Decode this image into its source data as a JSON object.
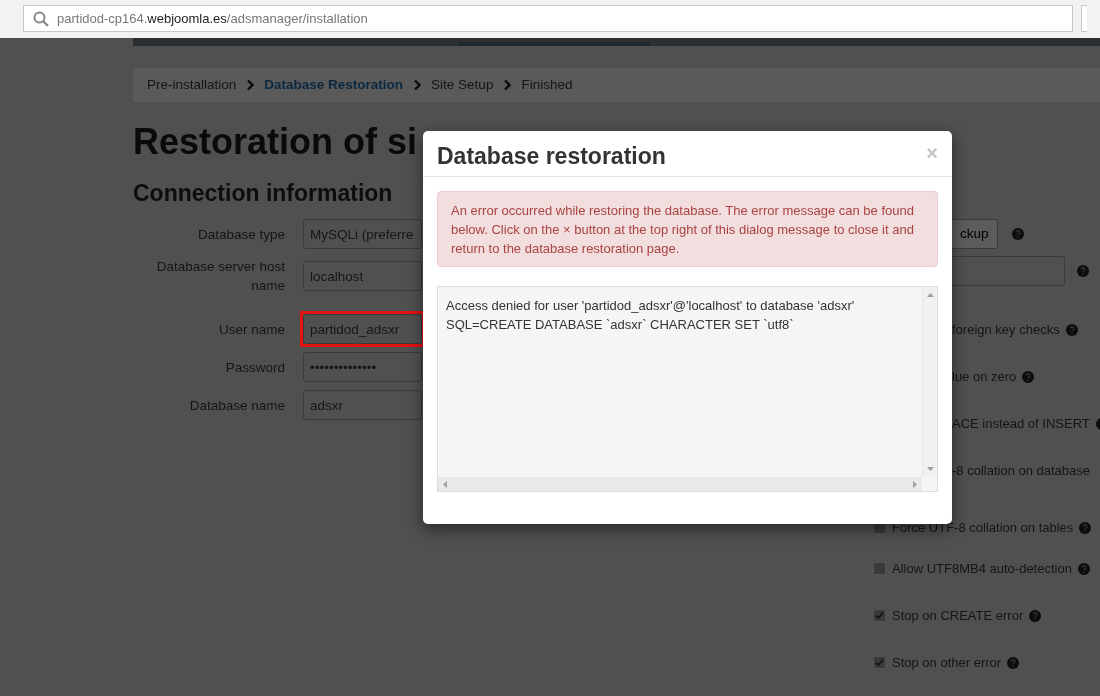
{
  "browser": {
    "url": "partidod-cp164.**webjoomla.es**/adsmanager/installation"
  },
  "breadcrumb": [
    {
      "label": "Pre-installation",
      "selected": false
    },
    {
      "label": "Database Restoration",
      "selected": true
    },
    {
      "label": "Site Setup",
      "selected": false
    },
    {
      "label": "Finished",
      "selected": false
    }
  ],
  "page_title": "Restoration of si",
  "section_title": "Connection information",
  "fields": [
    {
      "label": "Database type",
      "value": "MySQLi (preferre",
      "highlighted": false
    },
    {
      "label": "Database server host name",
      "value": "localhost",
      "highlighted": false
    },
    {
      "label": "User name",
      "value": "partidod_adsxr",
      "highlighted": true
    },
    {
      "label": "Password",
      "value": "••••••••••••••",
      "highlighted": false
    },
    {
      "label": "Database name",
      "value": "adsxr",
      "highlighted": false
    }
  ],
  "backup_button": {
    "label": "ckup"
  },
  "options": [
    {
      "label": "foreign key checks",
      "help": true
    },
    {
      "label": "lue on zero",
      "help": true
    },
    {
      "label": "ACE instead of INSERT",
      "help": true
    },
    {
      "label": "-8 collation on database",
      "help": false
    },
    {
      "label": "Force UTF-8 collation on tables",
      "checked": false,
      "help": true
    },
    {
      "label": "Allow UTF8MB4 auto-detection",
      "checked": false,
      "help": true
    },
    {
      "label": "Stop on CREATE error",
      "checked": true,
      "help": true
    },
    {
      "label": "Stop on other error",
      "checked": true,
      "help": true
    }
  ],
  "modal": {
    "title": "Database restoration",
    "close": "×",
    "alert": "An error occurred while restoring the database. The error message can be found below. Click on the × button at the top right of this dialog message to close it and return to the database restoration page.",
    "log_lines": [
      "Access denied for user 'partidod_adsxr'@'localhost' to database 'adsxr'",
      "SQL=CREATE DATABASE `adsxr` CHARACTER SET `utf8`"
    ]
  }
}
